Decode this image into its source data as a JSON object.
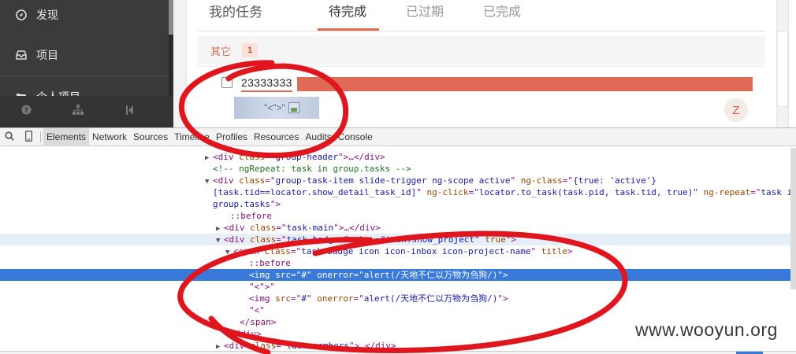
{
  "sidebar": {
    "items": [
      {
        "label": "发现",
        "icon": "compass-icon"
      },
      {
        "label": "项目",
        "icon": "inbox-icon"
      },
      {
        "label": "个人项目",
        "icon": "folder-icon"
      }
    ],
    "footer_icons": [
      "help-icon",
      "org-chart-icon",
      "collapse-icon"
    ]
  },
  "tabs": {
    "title": "我的任务",
    "items": [
      "待完成",
      "已过期",
      "已完成"
    ],
    "active": "待完成"
  },
  "group": {
    "name": "其它",
    "count": "1"
  },
  "task": {
    "title": "23333333",
    "project_badge": "\"<\">\"",
    "avatar_letter": "Z"
  },
  "devtools": {
    "tabs": [
      "Elements",
      "Network",
      "Sources",
      "Timeline",
      "Profiles",
      "Resources",
      "Audits",
      "Console"
    ],
    "active_tab": "Elements",
    "lines": [
      {
        "indent": 0,
        "tri": "",
        "text": "",
        "kind": "cut"
      },
      {
        "indent": 272,
        "tri": "▶",
        "parts": [
          [
            "tn",
            "<div "
          ],
          [
            "an",
            "class"
          ],
          [
            "tn",
            "=\""
          ],
          [
            "av",
            "group-header"
          ],
          [
            "tn",
            "\">…</div>"
          ]
        ]
      },
      {
        "indent": 272,
        "tri": "",
        "parts": [
          [
            "cm",
            "<!-- ngRepeat: task in group.tasks -->"
          ]
        ]
      },
      {
        "indent": 272,
        "tri": "▼",
        "parts": [
          [
            "tn",
            "<div "
          ],
          [
            "an",
            "class"
          ],
          [
            "tn",
            "=\""
          ],
          [
            "av",
            "group-task-item slide-trigger ng-scope active"
          ],
          [
            "tn",
            "\" "
          ],
          [
            "an",
            "ng-class"
          ],
          [
            "tn",
            "=\""
          ],
          [
            "av",
            "{true: 'active'}"
          ]
        ]
      },
      {
        "indent": 272,
        "tri": "",
        "parts": [
          [
            "av",
            "[task.tid==locator.show_detail_task_id]"
          ],
          [
            "tn",
            "\" "
          ],
          [
            "an",
            "ng-click"
          ],
          [
            "tn",
            "=\""
          ],
          [
            "av",
            "locator.to_task(task.pid, task.tid, true)"
          ],
          [
            "tn",
            "\" "
          ],
          [
            "an",
            "ng-repeat"
          ],
          [
            "tn",
            "=\""
          ],
          [
            "av",
            "task in"
          ]
        ]
      },
      {
        "indent": 272,
        "tri": "",
        "parts": [
          [
            "av",
            "group.tasks"
          ],
          [
            "tn",
            "\">"
          ]
        ]
      },
      {
        "indent": 294,
        "tri": "",
        "parts": [
          [
            "ps",
            "::before"
          ]
        ]
      },
      {
        "indent": 286,
        "tri": "▶",
        "parts": [
          [
            "tn",
            "<div "
          ],
          [
            "an",
            "class"
          ],
          [
            "tn",
            "=\""
          ],
          [
            "av",
            "task-main"
          ],
          [
            "tn",
            "\">…</div>"
          ]
        ]
      },
      {
        "indent": 286,
        "tri": "▼",
        "hover": true,
        "parts": [
          [
            "tn",
            "<div "
          ],
          [
            "an",
            "class"
          ],
          [
            "tn",
            "=\""
          ],
          [
            "av",
            "task-badges"
          ],
          [
            "tn",
            "\" "
          ],
          [
            "an",
            "show"
          ],
          [
            "tn",
            "=\""
          ],
          [
            "av",
            "task.show_project"
          ],
          [
            "tn",
            "\" "
          ],
          [
            "an",
            "true"
          ],
          [
            "tn",
            "\">"
          ]
        ]
      },
      {
        "indent": 298,
        "tri": "▼",
        "parts": [
          [
            "tn",
            "<span "
          ],
          [
            "an",
            "class"
          ],
          [
            "tn",
            "=\""
          ],
          [
            "av",
            "task-badge icon icon-inbox icon-project-name"
          ],
          [
            "tn",
            "\" "
          ],
          [
            "an",
            "title"
          ],
          [
            "tn",
            ">"
          ]
        ]
      },
      {
        "indent": 318,
        "tri": "",
        "parts": [
          [
            "ps",
            "::before"
          ]
        ]
      },
      {
        "indent": 318,
        "tri": "",
        "sel": true,
        "parts": [
          [
            "tn",
            "<img "
          ],
          [
            "an",
            "src"
          ],
          [
            "tn",
            "=\""
          ],
          [
            "av",
            "#"
          ],
          [
            "tn",
            "\" "
          ],
          [
            "an",
            "onerror"
          ],
          [
            "tn",
            "=\""
          ],
          [
            "av",
            "alert(/天地不仁以万物为刍狗/)"
          ],
          [
            "tn",
            "\">"
          ]
        ]
      },
      {
        "indent": 318,
        "tri": "",
        "parts": [
          [
            "tn",
            "\"<\">\""
          ]
        ]
      },
      {
        "indent": 318,
        "tri": "",
        "parts": [
          [
            "tn",
            "<img "
          ],
          [
            "an",
            "src"
          ],
          [
            "tn",
            "=\""
          ],
          [
            "av",
            "#"
          ],
          [
            "tn",
            "\" "
          ],
          [
            "an",
            "onerror"
          ],
          [
            "tn",
            "=\""
          ],
          [
            "av",
            "alert(/天地不仁以万物为刍狗/)"
          ],
          [
            "tn",
            "\">"
          ]
        ]
      },
      {
        "indent": 318,
        "tri": "",
        "parts": [
          [
            "tn",
            "\"<\""
          ]
        ]
      },
      {
        "indent": 306,
        "tri": "",
        "parts": [
          [
            "tn",
            "</span>"
          ]
        ]
      },
      {
        "indent": 294,
        "tri": "",
        "parts": [
          [
            "tn",
            "</div>"
          ]
        ]
      },
      {
        "indent": 286,
        "tri": "▶",
        "parts": [
          [
            "tn",
            "<div "
          ],
          [
            "an",
            "class"
          ],
          [
            "tn",
            "=\""
          ],
          [
            "av",
            "task-members"
          ],
          [
            "tn",
            "\">…</div>"
          ]
        ]
      }
    ]
  },
  "watermark": "www.wooyun.org",
  "colors": {
    "accent": "#e06c50",
    "selection": "#3879d9",
    "annotation": "#e0161e"
  }
}
